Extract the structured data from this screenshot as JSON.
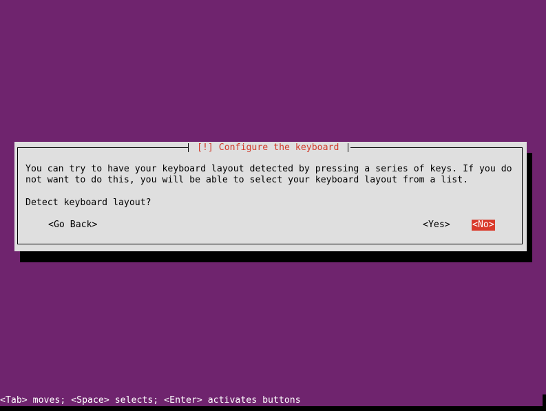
{
  "dialog": {
    "title": "[!] Configure the keyboard",
    "body_lines": [
      "You can try to have your keyboard layout detected by pressing a series of keys. If you do",
      "not want to do this, you will be able to select your keyboard layout from a list."
    ],
    "question": "Detect keyboard layout?",
    "buttons": {
      "go_back": "<Go Back>",
      "yes": "<Yes>",
      "no": "<No>"
    },
    "selected_button": "no"
  },
  "statusbar": {
    "help_text": "<Tab> moves; <Space> selects; <Enter> activates buttons"
  },
  "colors": {
    "background": "#6f246e",
    "dialog_bg": "#dfdfdf",
    "title_color": "#d03a2a",
    "selected_button_bg": "#d93a2b",
    "selected_button_fg": "#ffffff",
    "status_text": "#ffffff"
  }
}
